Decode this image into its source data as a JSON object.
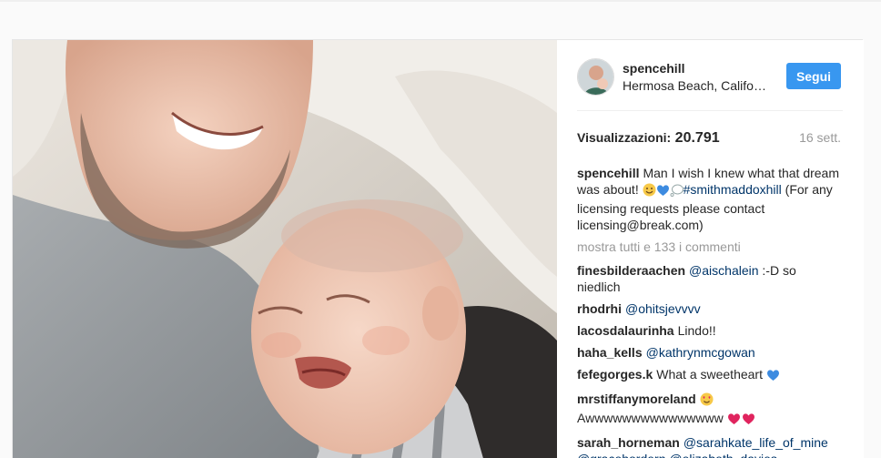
{
  "post": {
    "username": "spencehill",
    "location": "Hermosa Beach, Califo…",
    "follow_label": "Segui",
    "views_label": "Visualizzazioni:",
    "views_count": "20.791",
    "time": "16 sett.",
    "caption": {
      "username": "spencehill",
      "text_1": "Man I wish I knew what that dream was about!",
      "hashtag": "#smithmaddoxhill",
      "text_2": "(For any licensing requests please contact licensing@break.com)",
      "emojis": [
        "smile-emoji",
        "blue-heart-emoji",
        "thought-bubble-emoji"
      ]
    },
    "show_all_comments": "mostra tutti e 133 i commenti",
    "comments": [
      {
        "username": "finesbilderaachen",
        "mention": "@aischalein",
        "text": ":-D so niedlich"
      },
      {
        "username": "rhodrhi",
        "mention": "@ohitsjevvvv",
        "text": ""
      },
      {
        "username": "lacosdalaurinha",
        "mention": "",
        "text": "Lindo!!"
      },
      {
        "username": "haha_kells",
        "mention": "@kathrynmcgowan",
        "text": ""
      },
      {
        "username": "fefegorges.k",
        "mention": "",
        "text": "What a sweetheart",
        "emoji": "blue-heart-emoji"
      },
      {
        "username": "mrstiffanymoreland",
        "mention": "",
        "text": "Awwwwwwwwwwwwwww",
        "emoji_before": "heart-eyes-emoji",
        "emoji_after": "red-hearts-emoji"
      },
      {
        "username": "sarah_horneman",
        "mention": "@sarahkate_life_of_mine @gracehordern @elizabeth_davies",
        "text": ""
      }
    ]
  },
  "colors": {
    "accent": "#3897f0",
    "link": "#003569",
    "muted": "#999999",
    "text": "#262626"
  }
}
